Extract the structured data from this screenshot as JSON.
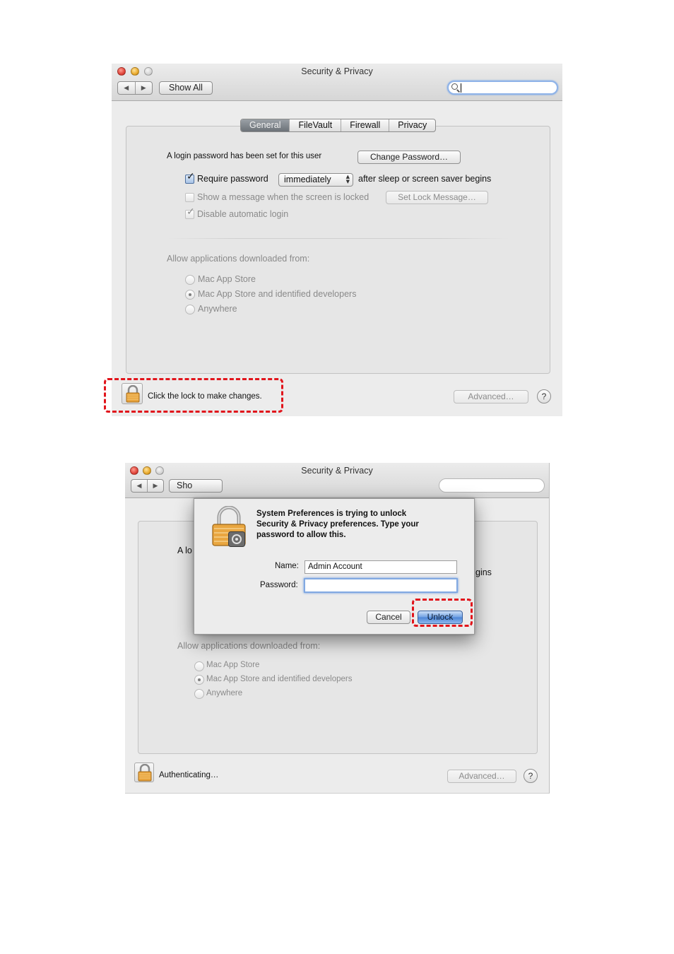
{
  "window1": {
    "title": "Security & Privacy",
    "show_all": "Show All",
    "tabs": [
      {
        "label": "General",
        "selected": true
      },
      {
        "label": "FileVault",
        "selected": false
      },
      {
        "label": "Firewall",
        "selected": false
      },
      {
        "label": "Privacy",
        "selected": false
      }
    ],
    "login_password_text": "A login password has been set for this user",
    "change_password_button": "Change Password…",
    "require_password_label": "Require password",
    "require_password_checked": true,
    "require_password_delay": "immediately",
    "after_sleep_text": "after sleep or screen saver begins",
    "show_message_label": "Show a message when the screen is locked",
    "show_message_checked": false,
    "set_lock_message_button": "Set Lock Message…",
    "disable_auto_login_label": "Disable automatic login",
    "disable_auto_login_checked": true,
    "allow_apps_heading": "Allow applications downloaded from:",
    "allow_options": [
      {
        "label": "Mac App Store",
        "selected": false
      },
      {
        "label": "Mac App Store and identified developers",
        "selected": true
      },
      {
        "label": "Anywhere",
        "selected": false
      }
    ],
    "lock_status": "Click the lock to make changes.",
    "advanced_button": "Advanced…",
    "help_button": "?"
  },
  "window2": {
    "title": "Security & Privacy",
    "show_all_partial": "Sho",
    "login_partial": "A lo",
    "logins_partial": "gins",
    "allow_apps_heading": "Allow applications downloaded from:",
    "allow_options": [
      {
        "label": "Mac App Store",
        "selected": false
      },
      {
        "label": "Mac App Store and identified developers",
        "selected": true
      },
      {
        "label": "Anywhere",
        "selected": false
      }
    ],
    "lock_status": "Authenticating…",
    "advanced_button": "Advanced…",
    "help_button": "?"
  },
  "dialog": {
    "message_line1": "System Preferences is trying to unlock",
    "message_line2": "Security & Privacy preferences. Type your",
    "message_line3": "password to allow this.",
    "name_label": "Name:",
    "name_value": "Admin Account",
    "password_label": "Password:",
    "password_value": "",
    "cancel_button": "Cancel",
    "unlock_button": "Unlock"
  },
  "colors": {
    "highlight": "#e1141b",
    "selected_tab": "#7d838a",
    "default_button": "#4d85d6",
    "focus_ring": "#82a9e2"
  }
}
